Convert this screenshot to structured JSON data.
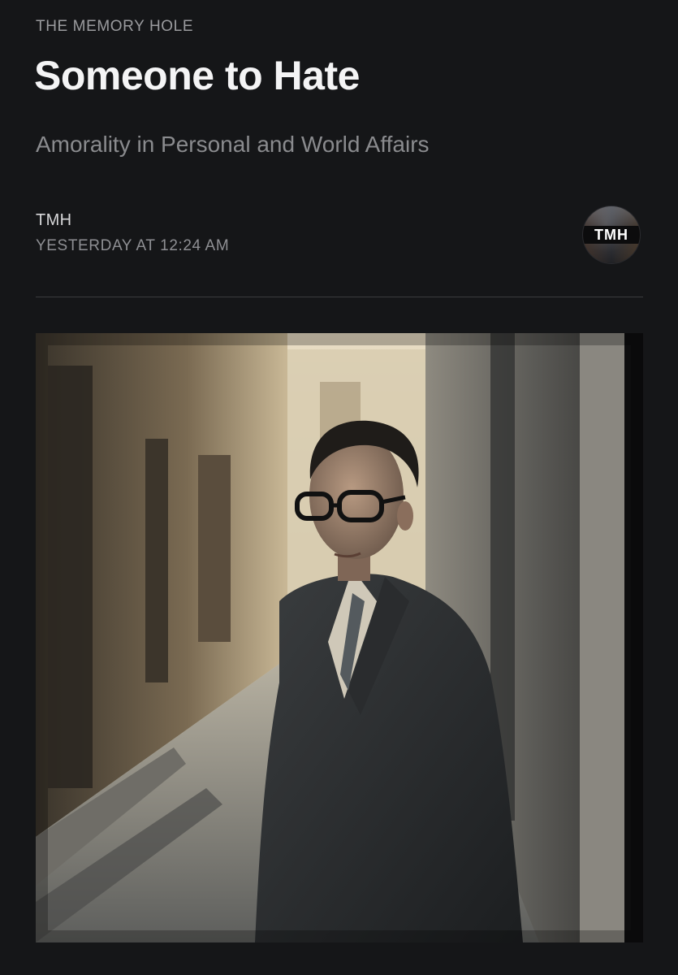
{
  "article": {
    "publication": "THE MEMORY HOLE",
    "title": "Someone to Hate",
    "subtitle": "Amorality in Personal and World Affairs",
    "author": "TMH",
    "timestamp": "YESTERDAY AT 12:24 AM"
  },
  "avatar": {
    "label": "TMH"
  },
  "colors": {
    "background": "#151618",
    "title": "#f4f4f5",
    "muted": "#8e8f93",
    "divider": "#3a3b3f"
  }
}
